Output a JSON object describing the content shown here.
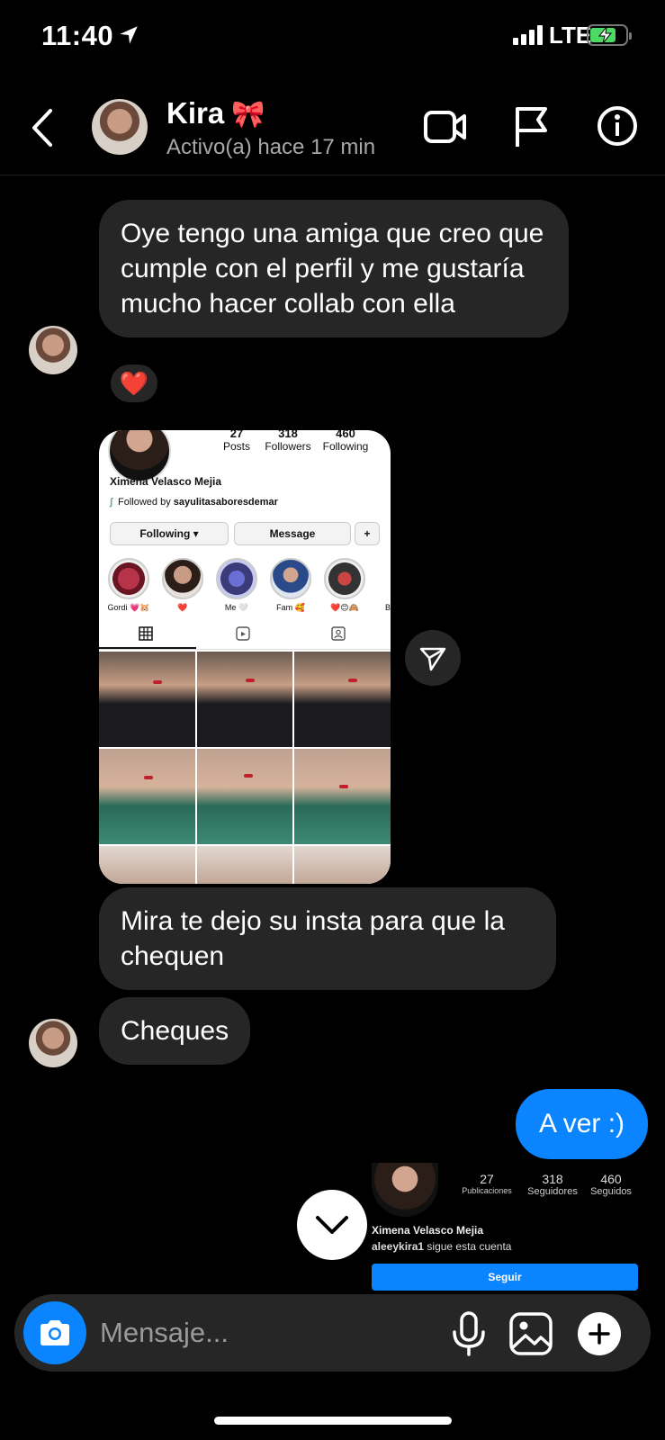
{
  "status_bar": {
    "time": "11:40",
    "network": "LTE"
  },
  "header": {
    "name": "Kira",
    "name_emoji": "🎀",
    "status": "Activo(a) hace 17 min",
    "icons": [
      "back-arrow",
      "video-camera",
      "flag",
      "info"
    ]
  },
  "messages": {
    "m1": "Oye tengo una amiga que creo que cumple con el perfil y me gustaría mucho hacer collab con ella",
    "m1_reaction": "❤️",
    "m2": "Mira te dejo su insta para que la chequen",
    "m3": "Cheques",
    "m4": "A ver :)"
  },
  "shared_screenshot": {
    "posts_num": "27",
    "posts_label": "Posts",
    "followers_num": "318",
    "followers_label": "Followers",
    "following_num": "460",
    "following_label": "Following",
    "name": "Ximena Velasco Mejia",
    "followed_prefix": "Followed by",
    "followed_by": "sayulitasaboresdemar",
    "btn_following": "Following ▾",
    "btn_message": "Message",
    "highlights": [
      "Gordi 💗🐹",
      "❤️",
      "Me 🤍",
      "Fam 🥰",
      "❤️😊🙈",
      "B"
    ]
  },
  "profile_preview": {
    "posts_num": "27",
    "posts_label": "Publicaciones",
    "followers_num": "318",
    "followers_label": "Seguidores",
    "following_num": "460",
    "following_label": "Seguidos",
    "name": "Ximena Velasco Mejia",
    "follows_user": "aleeykira1",
    "follows_text": "sigue esta cuenta",
    "follow_button": "Seguir"
  },
  "composer": {
    "placeholder": "Mensaje..."
  },
  "colors": {
    "accent": "#0a84ff",
    "bubble": "#262626",
    "background": "#000000",
    "battery": "#4cd964"
  }
}
